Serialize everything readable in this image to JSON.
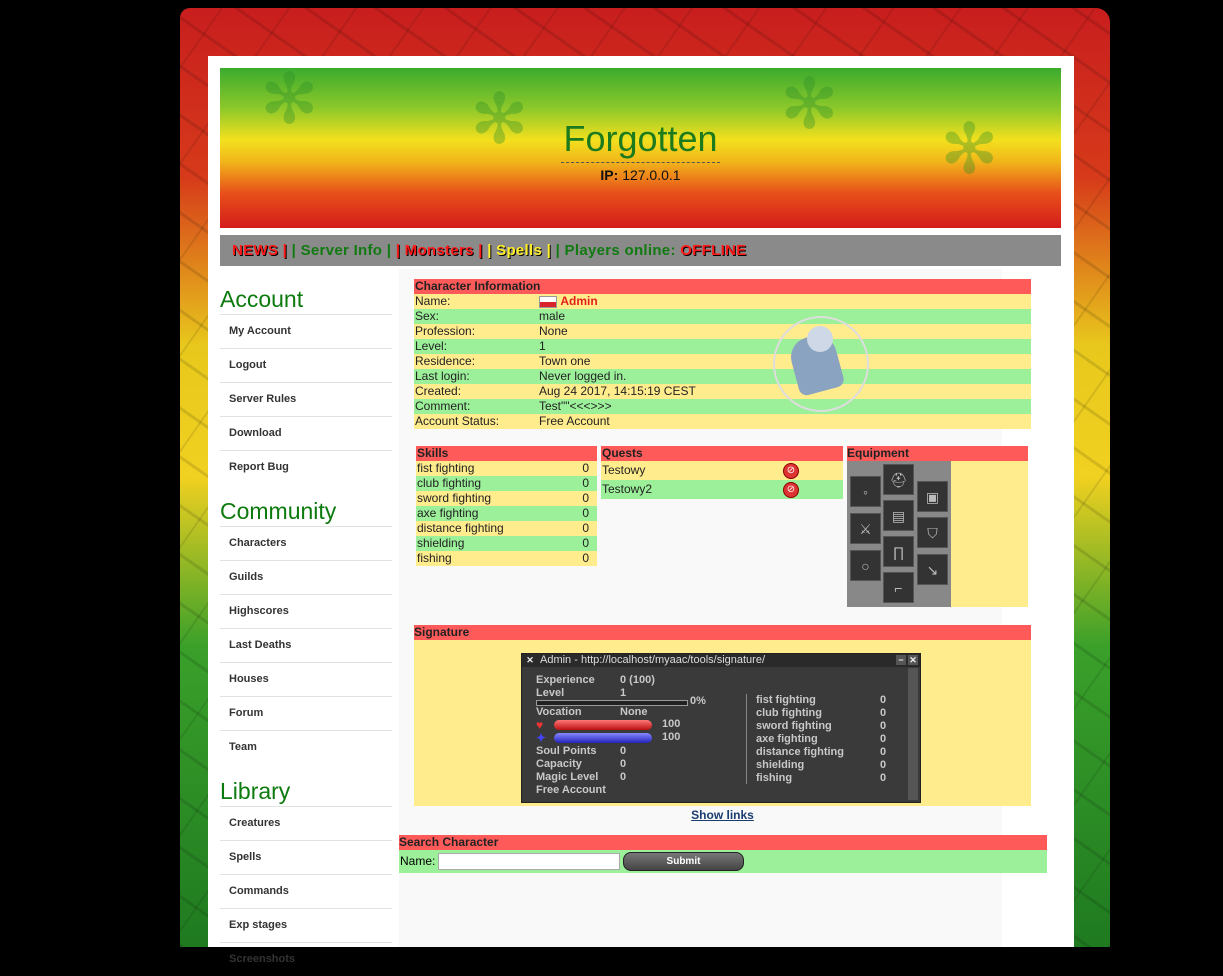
{
  "site": {
    "title": "Forgotten",
    "ip_label": "IP:",
    "ip": "127.0.0.1"
  },
  "menu": {
    "news": "NEWS |",
    "server_info": "| Server Info |",
    "monsters": "| Monsters |",
    "spells": "| Spells |",
    "players_prefix": "| Players online:",
    "players_status": "OFFLINE"
  },
  "sidebar": {
    "account": {
      "title": "Account",
      "items": [
        "My Account",
        "Logout",
        "Server Rules",
        "Download",
        "Report Bug"
      ]
    },
    "community": {
      "title": "Community",
      "items": [
        "Characters",
        "Guilds",
        "Highscores",
        "Last Deaths",
        "Houses",
        "Forum",
        "Team"
      ]
    },
    "library": {
      "title": "Library",
      "items": [
        "Creatures",
        "Spells",
        "Commands",
        "Exp stages",
        "Screenshots"
      ]
    }
  },
  "character": {
    "header": "Character Information",
    "rows": [
      {
        "label": "Name:",
        "value": "Admin"
      },
      {
        "label": "Sex:",
        "value": "male"
      },
      {
        "label": "Profession:",
        "value": "None"
      },
      {
        "label": "Level:",
        "value": "1"
      },
      {
        "label": "Residence:",
        "value": "Town one"
      },
      {
        "label": "Last login:",
        "value": "Never logged in."
      },
      {
        "label": "Created:",
        "value": "Aug 24 2017, 14:15:19 CEST"
      },
      {
        "label": "Comment:",
        "value": "Test\"\"<<<>>>"
      },
      {
        "label": "Account Status:",
        "value": "Free Account"
      }
    ]
  },
  "skills": {
    "header": "Skills",
    "rows": [
      {
        "name": "fist fighting",
        "value": "0"
      },
      {
        "name": "club fighting",
        "value": "0"
      },
      {
        "name": "sword fighting",
        "value": "0"
      },
      {
        "name": "axe fighting",
        "value": "0"
      },
      {
        "name": "distance fighting",
        "value": "0"
      },
      {
        "name": "shielding",
        "value": "0"
      },
      {
        "name": "fishing",
        "value": "0"
      }
    ]
  },
  "quests": {
    "header": "Quests",
    "rows": [
      "Testowy",
      "Testowy2"
    ]
  },
  "equipment": {
    "header": "Equipment"
  },
  "signature": {
    "header": "Signature",
    "window_title": "Admin - http://localhost/myaac/tools/signature/",
    "experience_label": "Experience",
    "experience": "0 (100)",
    "level_label": "Level",
    "level": "1",
    "progress": "0%",
    "vocation_label": "Vocation",
    "vocation": "None",
    "health": "100",
    "mana": "100",
    "soul_label": "Soul Points",
    "soul": "0",
    "capacity_label": "Capacity",
    "capacity": "0",
    "magic_label": "Magic Level",
    "magic": "0",
    "account": "Free Account",
    "skills": [
      {
        "name": "fist fighting",
        "value": "0"
      },
      {
        "name": "club fighting",
        "value": "0"
      },
      {
        "name": "sword fighting",
        "value": "0"
      },
      {
        "name": "axe fighting",
        "value": "0"
      },
      {
        "name": "distance fighting",
        "value": "0"
      },
      {
        "name": "shielding",
        "value": "0"
      },
      {
        "name": "fishing",
        "value": "0"
      }
    ],
    "show_links": "Show links"
  },
  "search": {
    "header": "Search Character",
    "label": "Name:",
    "submit": "Submit"
  },
  "colors": {
    "header_red": "#ff5a5a",
    "row_yellow": "#ffec8c",
    "row_green": "#9cf09a",
    "title_green": "#0d7a0d"
  }
}
